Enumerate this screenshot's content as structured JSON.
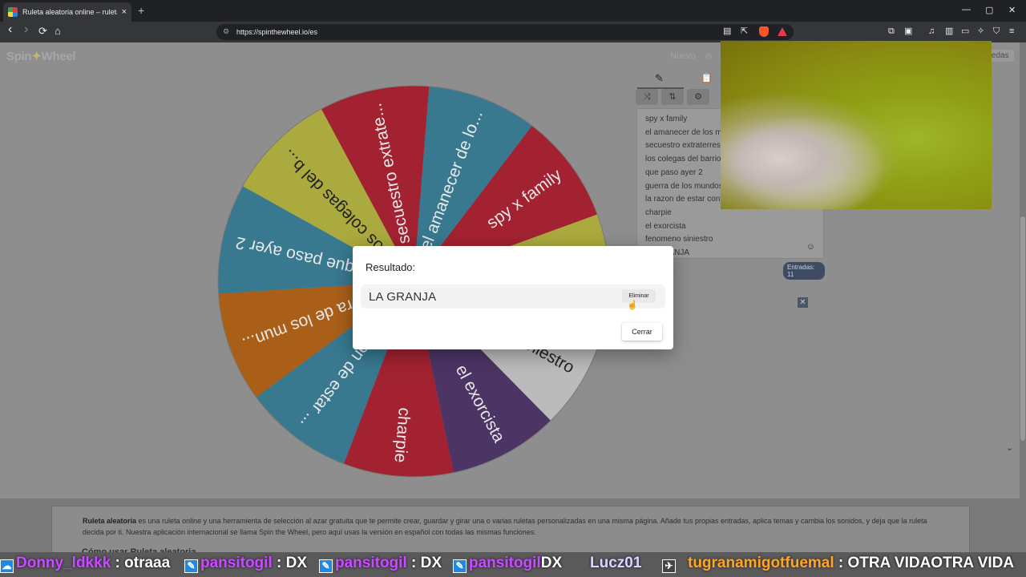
{
  "browser": {
    "tab_title": "Ruleta aleatoria online – ruleta d",
    "tab_close": "×",
    "new_tab": "+",
    "url": "https://spinthewheel.io/es",
    "back_icon": "‹",
    "forward_icon": "›",
    "reload_icon": "⟳",
    "home_icon": "⌂",
    "minimize": "—",
    "maximize": "▢",
    "close": "✕"
  },
  "header": {
    "logo_a": "Spin",
    "logo_star": "✦",
    "logo_b": "Wheel",
    "nuevo": "Nuevo",
    "ruedas": "ruedas"
  },
  "wheel": {
    "segments": [
      {
        "label": "spy x family",
        "color": "#ae1a2b"
      },
      {
        "label": "el amanecer de lo...",
        "color": "#337f9a"
      },
      {
        "label": "secuestro extrate...",
        "color": "#ae1a2b"
      },
      {
        "label": "los colegas del b...",
        "color": "#b9b83a"
      },
      {
        "label": "que paso ayer 2",
        "color": "#337f9a"
      },
      {
        "label": "guerra de los mun...",
        "color": "#b8610f"
      },
      {
        "label": "la razon de estar ...",
        "color": "#337f9a"
      },
      {
        "label": "charpie",
        "color": "#ae1a2b"
      },
      {
        "label": "el exorcista",
        "color": "#4a2e66"
      },
      {
        "label": "fenomeno siniestro",
        "color": "#cbcbcb"
      },
      {
        "label": "LA GRANJA",
        "color": "#b9b83a"
      }
    ]
  },
  "panel": {
    "pencil_icon": "✎",
    "clipboard_icon": "📋",
    "shuffle_icon": "⤨",
    "sort_icon": "⇅",
    "gear_icon": "⚙",
    "entries": [
      "spy x family",
      "el amanecer de los muertos",
      "secuestro extraterrestre",
      "los colegas del barrio",
      "que paso ayer 2",
      "guerra de los mundos",
      "la razon de estar contigo",
      "charpie",
      "el exorcista",
      "fenomeno siniestro",
      "LA GRANJA"
    ],
    "emoji_icon": "☺",
    "count": "Entradas: 11"
  },
  "close_x": "✕",
  "description": {
    "bold": "Ruleta aleatoria",
    "text": " es una ruleta online y una herramienta de selección al azar gratuita que te permite crear, guardar y girar una o varias ruletas personalizadas en una misma página. Añade tus propias entradas, aplica temas y cambia los sonidos, y deja que la ruleta decida por ti. Nuestra aplicación internacional se llama Spin the Wheel, pero aquí usas la versión en español con todas las mismas funciones.",
    "subheading": "Cómo usar Ruleta aleatoria"
  },
  "dialog": {
    "title": "Resultado:",
    "result": "LA GRANJA",
    "remove": "Eliminar",
    "close": "Cerrar"
  },
  "ticker": [
    {
      "name": "Donny_ldkkk",
      "msg": ": otraaa"
    },
    {
      "name": "pansitogil",
      "msg": ": DX"
    },
    {
      "name": "pansitogil",
      "msg": ": DX"
    },
    {
      "name": "pansitogil",
      "msg": "DX"
    },
    {
      "name": "Lucz01",
      "msg": ""
    },
    {
      "name": "tugranamigotfuemal",
      "msg": ": OTRA VIDAOTRA VIDA"
    }
  ]
}
